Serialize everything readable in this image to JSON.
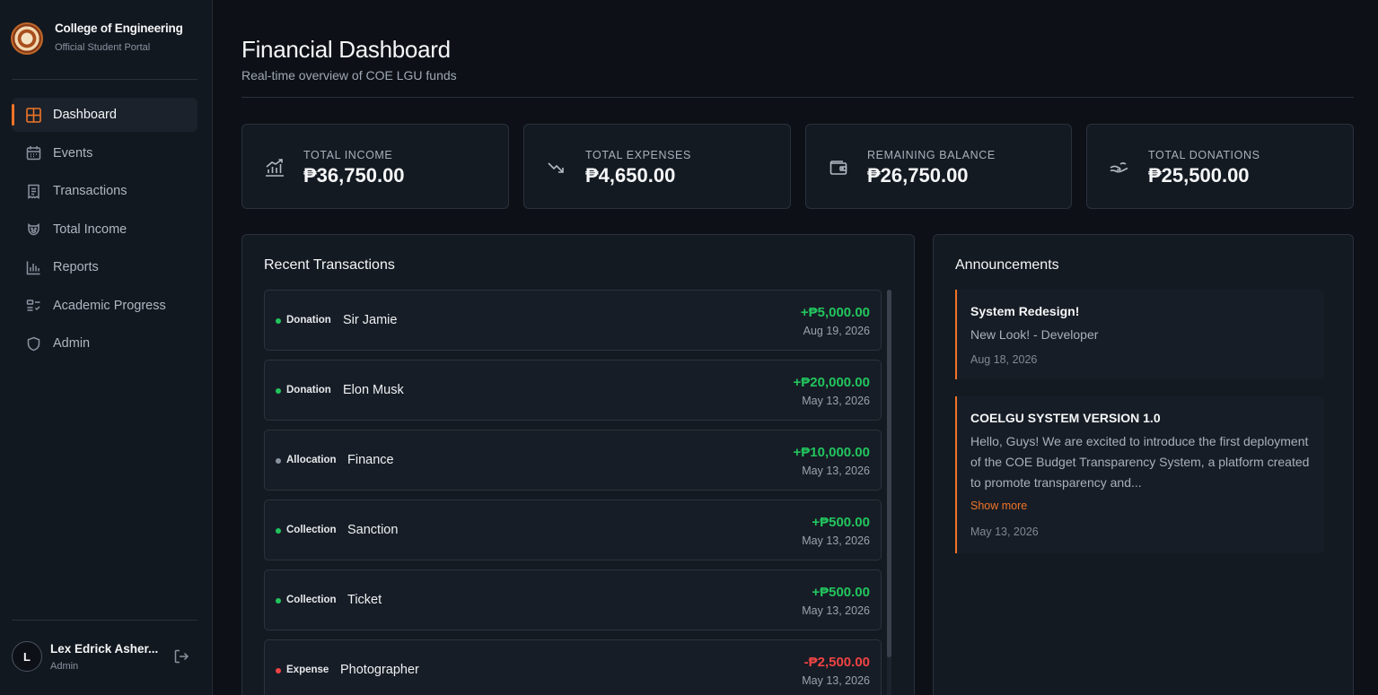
{
  "brand": {
    "title": "College of Engineering",
    "subtitle": "Official Student Portal"
  },
  "nav": [
    {
      "label": "Dashboard",
      "icon": "dashboard-grid-icon",
      "active": true
    },
    {
      "label": "Events",
      "icon": "calendar-icon",
      "active": false
    },
    {
      "label": "Transactions",
      "icon": "receipt-icon",
      "active": false
    },
    {
      "label": "Total Income",
      "icon": "piggy-bank-icon",
      "active": false
    },
    {
      "label": "Reports",
      "icon": "bar-chart-icon",
      "active": false
    },
    {
      "label": "Academic Progress",
      "icon": "checklist-icon",
      "active": false
    },
    {
      "label": "Admin",
      "icon": "shield-icon",
      "active": false
    }
  ],
  "user": {
    "initial": "L",
    "name": "Lex Edrick Asher...",
    "role": "Admin"
  },
  "header": {
    "title": "Financial Dashboard",
    "subtitle": "Real-time overview of COE LGU funds"
  },
  "stats": [
    {
      "label": "TOTAL INCOME",
      "value": "₱36,750.00",
      "icon": "chart-up-icon"
    },
    {
      "label": "TOTAL EXPENSES",
      "value": "₱4,650.00",
      "icon": "trend-down-icon"
    },
    {
      "label": "REMAINING BALANCE",
      "value": "₱26,750.00",
      "icon": "wallet-icon"
    },
    {
      "label": "TOTAL DONATIONS",
      "value": "₱25,500.00",
      "icon": "hand-coins-icon"
    }
  ],
  "recent": {
    "title": "Recent Transactions",
    "items": [
      {
        "category": "Donation",
        "name": "Sir Jamie",
        "amount": "+₱5,000.00",
        "date": "Aug 19, 2026",
        "dot_color": "#22c55e",
        "amount_color": "#22c55e"
      },
      {
        "category": "Donation",
        "name": "Elon Musk",
        "amount": "+₱20,000.00",
        "date": "May 13, 2026",
        "dot_color": "#22c55e",
        "amount_color": "#22c55e"
      },
      {
        "category": "Allocation",
        "name": "Finance",
        "amount": "+₱10,000.00",
        "date": "May 13, 2026",
        "dot_color": "#8a93a0",
        "amount_color": "#22c55e"
      },
      {
        "category": "Collection",
        "name": "Sanction",
        "amount": "+₱500.00",
        "date": "May 13, 2026",
        "dot_color": "#22c55e",
        "amount_color": "#22c55e"
      },
      {
        "category": "Collection",
        "name": "Ticket",
        "amount": "+₱500.00",
        "date": "May 13, 2026",
        "dot_color": "#22c55e",
        "amount_color": "#22c55e"
      },
      {
        "category": "Expense",
        "name": "Photographer",
        "amount": "-₱2,500.00",
        "date": "May 13, 2026",
        "dot_color": "#ef4444",
        "amount_color": "#ef4444"
      }
    ]
  },
  "announcements": {
    "title": "Announcements",
    "items": [
      {
        "title": "System Redesign!",
        "body": "New Look! - Developer",
        "date": "Aug 18, 2026"
      },
      {
        "title": "COELGU SYSTEM VERSION 1.0",
        "body": "Hello, Guys! We are excited to introduce the first deployment of the COE Budget Transparency System, a platform created to promote transparency and...",
        "more": "Show more",
        "date": "May 13, 2026"
      }
    ]
  }
}
